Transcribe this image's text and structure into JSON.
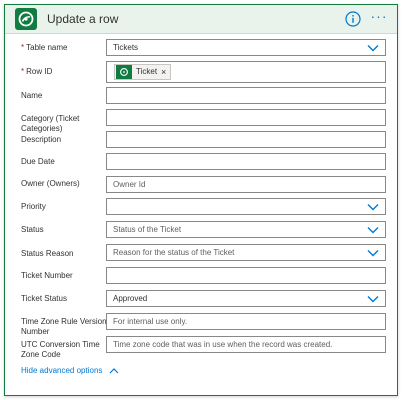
{
  "header": {
    "title": "Update a row",
    "info_icon": "info-icon",
    "more_label": "···",
    "logo_icon": "dataverse-logo-icon",
    "accent_color": "#107c41",
    "header_bg": "#e9f3ec"
  },
  "fields": [
    {
      "label": "Table name",
      "required": true,
      "value": "Tickets",
      "placeholder": "",
      "dropdown": true
    },
    {
      "label": "Row ID",
      "required": true,
      "token": "Ticket",
      "token_icon": "dataverse-token-icon"
    },
    {
      "label": "Name",
      "required": false,
      "value": "",
      "placeholder": "",
      "dropdown": false
    },
    {
      "label": "Category (Ticket Categories)",
      "required": false,
      "value": "",
      "placeholder": "",
      "dropdown": false
    },
    {
      "label": "Description",
      "required": false,
      "value": "",
      "placeholder": "",
      "dropdown": false
    },
    {
      "label": "Due Date",
      "required": false,
      "value": "",
      "placeholder": "",
      "dropdown": false
    },
    {
      "label": "Owner (Owners)",
      "required": false,
      "value": "",
      "placeholder": "Owner Id",
      "dropdown": false
    },
    {
      "label": "Priority",
      "required": false,
      "value": "",
      "placeholder": "",
      "dropdown": true
    },
    {
      "label": "Status",
      "required": false,
      "value": "",
      "placeholder": "Status of the Ticket",
      "dropdown": true
    },
    {
      "label": "Status Reason",
      "required": false,
      "value": "",
      "placeholder": "Reason for the status of the Ticket",
      "dropdown": true
    },
    {
      "label": "Ticket Number",
      "required": false,
      "value": "",
      "placeholder": "",
      "dropdown": false
    },
    {
      "label": "Ticket Status",
      "required": false,
      "value": "Approved",
      "placeholder": "",
      "dropdown": true
    },
    {
      "label": "Time Zone Rule Version Number",
      "required": false,
      "value": "",
      "placeholder": "For internal use only.",
      "dropdown": false
    },
    {
      "label": "UTC Conversion Time Zone Code",
      "required": false,
      "value": "",
      "placeholder": "Time zone code that was in use when the record was created.",
      "dropdown": false
    }
  ],
  "advanced_label": "Hide advanced options",
  "advanced_icon": "chevron-up-icon"
}
